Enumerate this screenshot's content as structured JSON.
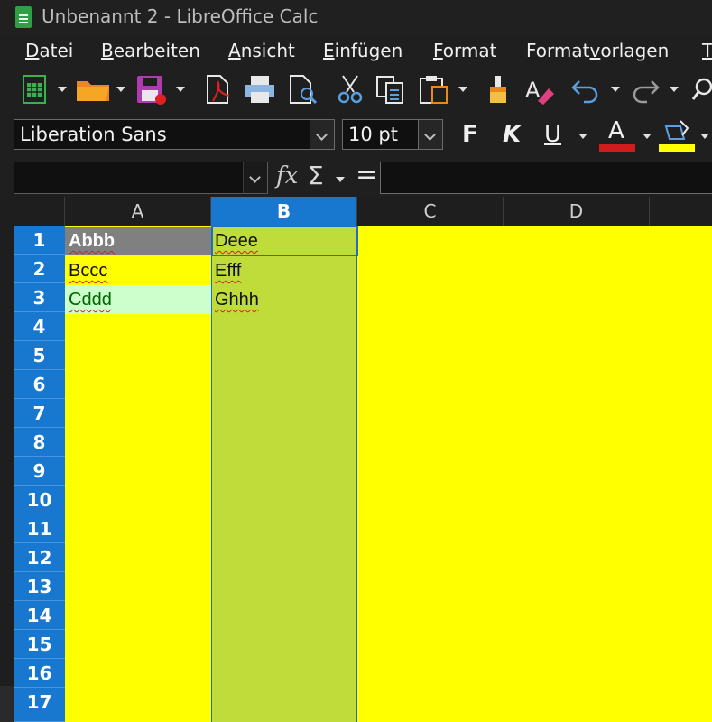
{
  "window": {
    "title": "Unbenannt 2 - LibreOffice Calc"
  },
  "menubar": {
    "items": [
      {
        "pre": "",
        "u": "D",
        "post": "atei"
      },
      {
        "pre": "",
        "u": "B",
        "post": "earbeiten"
      },
      {
        "pre": "",
        "u": "A",
        "post": "nsicht"
      },
      {
        "pre": "",
        "u": "E",
        "post": "infügen"
      },
      {
        "pre": "",
        "u": "F",
        "post": "ormat"
      },
      {
        "pre": "Format",
        "u": "v",
        "post": "orlagen"
      },
      {
        "pre": "",
        "u": "T",
        "post": ""
      }
    ]
  },
  "formatting": {
    "font_name": "Liberation Sans",
    "font_size": "10 pt",
    "bold_label": "F",
    "italic_label": "K",
    "underline_label": "U",
    "font_color_label": "A",
    "font_color": "#d01c1c",
    "highlight_color": "#ffff00"
  },
  "formula_bar": {
    "name_box": "",
    "content": "",
    "fx": "fx",
    "sigma": "Σ",
    "equals": "="
  },
  "grid": {
    "columns": [
      "A",
      "B",
      "C",
      "D"
    ],
    "selected_column": "B",
    "rows": [
      "1",
      "2",
      "3",
      "4",
      "5",
      "6",
      "7",
      "8",
      "9",
      "10",
      "11",
      "12",
      "13",
      "14",
      "15",
      "16",
      "17"
    ],
    "cells": {
      "A1": "Abbb",
      "A2": "Bccc",
      "A3": "Cddd",
      "B1": "Deee",
      "B2": "Efff",
      "B3": "Ghhh"
    },
    "colors": {
      "sheet_background": "#ffff00",
      "column_b_background": "#c0dc3a",
      "a1_background": "#808080",
      "a3_background": "#ccffcc",
      "a3_text": "#006600",
      "header_selected": "#1878d0"
    }
  }
}
